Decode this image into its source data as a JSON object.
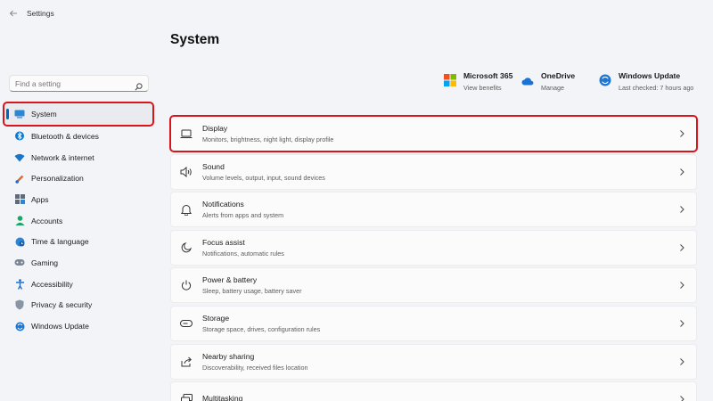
{
  "window": {
    "title": "Settings"
  },
  "search": {
    "placeholder": "Find a setting"
  },
  "sidebar": {
    "items": [
      {
        "label": "System",
        "icon": "monitor-icon",
        "active": true
      },
      {
        "label": "Bluetooth & devices",
        "icon": "bluetooth-icon"
      },
      {
        "label": "Network & internet",
        "icon": "wifi-icon"
      },
      {
        "label": "Personalization",
        "icon": "brush-icon"
      },
      {
        "label": "Apps",
        "icon": "apps-icon"
      },
      {
        "label": "Accounts",
        "icon": "person-icon"
      },
      {
        "label": "Time & language",
        "icon": "globe-clock-icon"
      },
      {
        "label": "Gaming",
        "icon": "gamepad-icon"
      },
      {
        "label": "Accessibility",
        "icon": "accessibility-icon"
      },
      {
        "label": "Privacy & security",
        "icon": "shield-icon"
      },
      {
        "label": "Windows Update",
        "icon": "update-icon"
      }
    ]
  },
  "main": {
    "title": "System",
    "quick": [
      {
        "title": "Microsoft 365",
        "subtitle": "View benefits",
        "icon": "microsoft-logo-icon"
      },
      {
        "title": "OneDrive",
        "subtitle": "Manage",
        "icon": "cloud-icon"
      },
      {
        "title": "Windows Update",
        "subtitle": "Last checked: 7 hours ago",
        "icon": "update-icon"
      }
    ],
    "cards": [
      {
        "title": "Display",
        "subtitle": "Monitors, brightness, night light, display profile",
        "icon": "laptop-icon"
      },
      {
        "title": "Sound",
        "subtitle": "Volume levels, output, input, sound devices",
        "icon": "speaker-icon"
      },
      {
        "title": "Notifications",
        "subtitle": "Alerts from apps and system",
        "icon": "bell-icon"
      },
      {
        "title": "Focus assist",
        "subtitle": "Notifications, automatic rules",
        "icon": "moon-icon"
      },
      {
        "title": "Power & battery",
        "subtitle": "Sleep, battery usage, battery saver",
        "icon": "power-icon"
      },
      {
        "title": "Storage",
        "subtitle": "Storage space, drives, configuration rules",
        "icon": "storage-icon"
      },
      {
        "title": "Nearby sharing",
        "subtitle": "Discoverability, received files location",
        "icon": "share-icon"
      },
      {
        "title": "Multitasking",
        "subtitle": "",
        "icon": "multitask-icon"
      }
    ]
  },
  "colors": {
    "accent": "#0067c0",
    "highlight": "#d9141b",
    "background": "#f2f4f8"
  }
}
